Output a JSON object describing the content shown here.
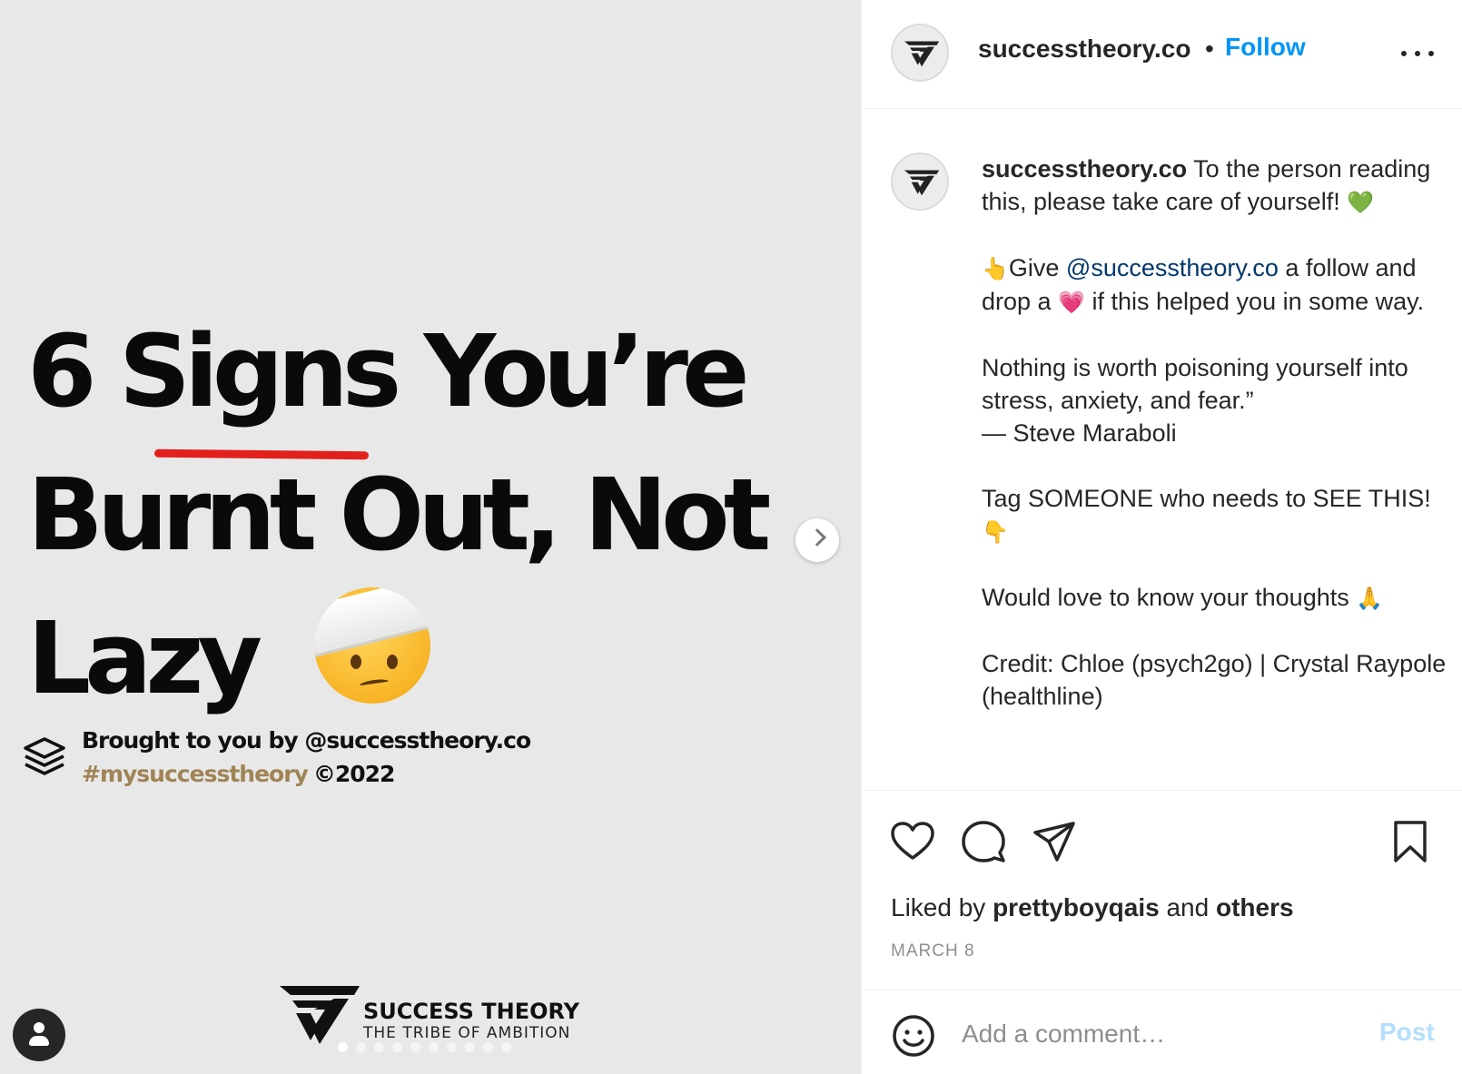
{
  "slide": {
    "title_line1": "6 Signs You’re",
    "title_line2": "Burnt Out, Not",
    "title_line3": "Lazy",
    "brought_by": "Brought to you by @successtheory.co",
    "hashtag": "#mysuccesstheory",
    "copyright": "©2022",
    "brand_name": "SUCCESS THEORY",
    "brand_tagline": "THE TRIBE OF AMBITION",
    "slide_count": 10,
    "active_slide": 1
  },
  "header": {
    "username": "successtheory.co",
    "separator": "•",
    "follow_label": "Follow"
  },
  "caption": {
    "username": "successtheory.co",
    "intro": " To the person reading this, please take care of yourself! ",
    "intro_emoji": "💚",
    "p2_emoji": "👆",
    "p2_a": "Give ",
    "p2_mention": "@successtheory.co",
    "p2_b": " a follow and drop a ",
    "p2_heart": "💗",
    "p2_c": " if this helped you in some way.",
    "quote_a": "Nothing is worth poisoning yourself into stress, anxiety, and fear.”",
    "quote_b": "— Steve Maraboli",
    "tag_text": "Tag SOMEONE who needs to SEE THIS! ",
    "tag_emoji": "👇",
    "thoughts_text": "Would love to know your thoughts ",
    "thoughts_emoji": "🙏",
    "credit": "Credit: Chloe (psych2go) | Crystal Raypole (healthline)"
  },
  "likes": {
    "prefix": "Liked by ",
    "user": "prettyboyqais",
    "middle": " and ",
    "others": "others"
  },
  "date": "MARCH 8",
  "comment": {
    "placeholder": "Add a comment…",
    "post_label": "Post"
  },
  "colors": {
    "accent": "#0095f6",
    "mention": "#00376b",
    "hashtag_gold": "#a08455",
    "underline_red": "#e2211c",
    "post_disabled": "#b2dffc"
  }
}
